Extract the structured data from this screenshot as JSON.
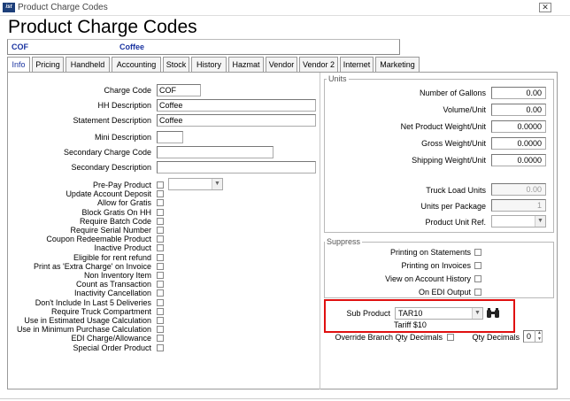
{
  "window": {
    "title": "Product Charge Codes",
    "icon": "app-logo-icon",
    "close_glyph": "✕"
  },
  "header": {
    "title": "Product Charge Codes",
    "code": "COF",
    "description": "Coffee"
  },
  "tabs": [
    "Info",
    "Pricing",
    "Handheld",
    "Accounting",
    "Stock",
    "History",
    "Hazmat",
    "Vendor",
    "Vendor 2",
    "Internet",
    "Marketing"
  ],
  "active_tab": "Info",
  "info": {
    "charge_code": {
      "label": "Charge Code",
      "value": "COF"
    },
    "hh_description": {
      "label": "HH Description",
      "value": "Coffee"
    },
    "statement_description": {
      "label": "Statement Description",
      "value": "Coffee"
    },
    "mini_description": {
      "label": "Mini Description",
      "value": ""
    },
    "secondary_charge_code": {
      "label": "Secondary Charge Code",
      "value": ""
    },
    "secondary_description": {
      "label": "Secondary Description",
      "value": ""
    },
    "flags": [
      "Pre-Pay Product",
      "Update Account Deposit",
      "Allow for Gratis",
      "Block Gratis On HH",
      "Require Batch Code",
      "Require Serial Number",
      "Coupon Redeemable Product",
      "Inactive Product",
      "Eligible for rent refund",
      "Print as 'Extra Charge' on Invoice",
      "Non Inventory Item",
      "Count as Transaction",
      "Inactivity Cancellation",
      "Don't Include In Last 5 Deliveries",
      "Require Truck Compartment",
      "Use in Estimated Usage Calculation",
      "Use in Minimum Purchase Calculation",
      "EDI Charge/Allowance",
      "Special Order Product"
    ]
  },
  "units": {
    "title": "Units",
    "fields": [
      {
        "label": "Number of Gallons",
        "value": "0.00"
      },
      {
        "label": "Volume/Unit",
        "value": "0.00"
      },
      {
        "label": "Net Product Weight/Unit",
        "value": "0.0000"
      },
      {
        "label": "Gross Weight/Unit",
        "value": "0.0000"
      },
      {
        "label": "Shipping Weight/Unit",
        "value": "0.0000"
      }
    ],
    "truck_load_units": {
      "label": "Truck Load Units",
      "value": "0.00"
    },
    "units_per_package": {
      "label": "Units per Package",
      "value": "1"
    },
    "product_unit_ref": {
      "label": "Product Unit Ref.",
      "value": ""
    }
  },
  "suppress": {
    "title": "Suppress",
    "items": [
      "Printing on Statements",
      "Printing on Invoices",
      "View on Account History",
      "On EDI Output"
    ]
  },
  "sub_product": {
    "label": "Sub Product",
    "value": "TAR10",
    "description": "Tariff $10",
    "search_icon": "binoculars-icon"
  },
  "override_branch_qty": {
    "label": "Override Branch Qty Decimals"
  },
  "qty_decimals": {
    "label": "Qty Decimals",
    "value": "0"
  },
  "colors": {
    "accent_blue": "#1a33a0",
    "highlight_red": "#e01010"
  }
}
